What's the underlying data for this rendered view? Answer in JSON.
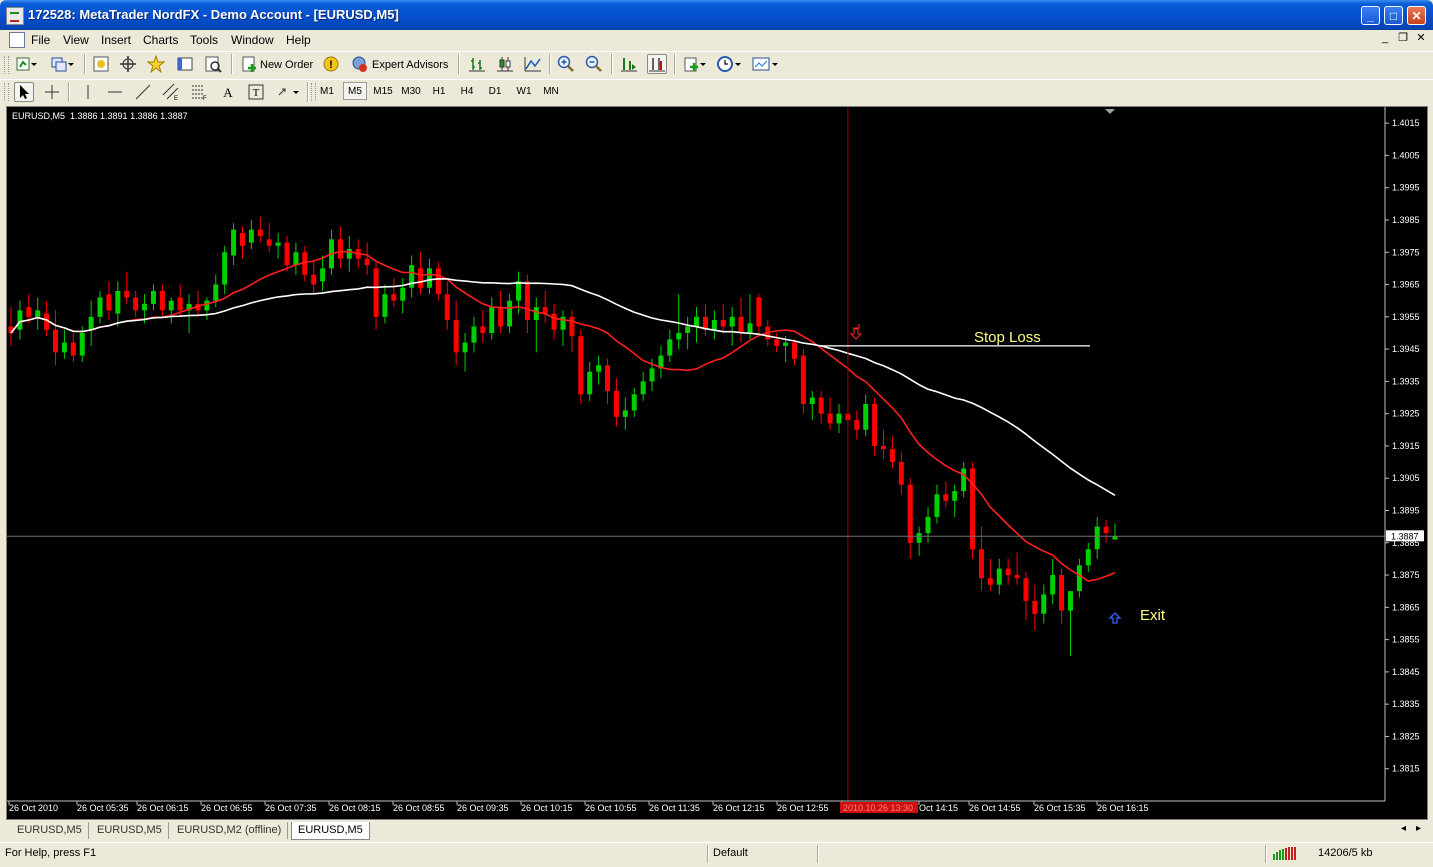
{
  "window": {
    "title": "172528: MetaTrader NordFX - Demo Account - [EURUSD,M5]",
    "minimize": "_",
    "maximize": "□",
    "close": "✕"
  },
  "menu": {
    "items": [
      "File",
      "View",
      "Insert",
      "Charts",
      "Tools",
      "Window",
      "Help"
    ]
  },
  "toolbar": {
    "new_order_label": "New Order",
    "expert_advisors_label": "Expert Advisors",
    "timeframes": [
      "M1",
      "M5",
      "M15",
      "M30",
      "H1",
      "H4",
      "D1",
      "W1",
      "MN"
    ],
    "active_timeframe": "M5"
  },
  "chart": {
    "info": "EURUSD,M5  1.3886 1.3891 1.3886 1.3887",
    "price_ticks": [
      "1.4015",
      "1.4005",
      "1.3995",
      "1.3985",
      "1.3975",
      "1.3965",
      "1.3955",
      "1.3945",
      "1.3935",
      "1.3925",
      "1.3915",
      "1.3905",
      "1.3895",
      "1.3885",
      "1.3875",
      "1.3865",
      "1.3855",
      "1.3845",
      "1.3835",
      "1.3825",
      "1.3815"
    ],
    "current_price": "1.3887",
    "time_labels": [
      "26 Oct 2010",
      "26 Oct 05:35",
      "26 Oct 06:15",
      "26 Oct 06:55",
      "26 Oct 07:35",
      "26 Oct 08:15",
      "26 Oct 08:55",
      "26 Oct 09:35",
      "26 Oct 10:15",
      "26 Oct 10:55",
      "26 Oct 11:35",
      "26 Oct 12:15",
      "26 Oct 12:55",
      "2010.10.26 13:30",
      "Oct 14:15",
      "26 Oct 14:55",
      "26 Oct 15:35",
      "26 Oct 16:15"
    ],
    "stop_loss_label": "Stop Loss",
    "exit_label": "Exit",
    "colors": {
      "background": "#000000",
      "bull": "#00d000",
      "bear": "#ff0000",
      "ma_fast": "#ff2020",
      "ma_slow": "#ffffff",
      "annotation_text": "#ffff80",
      "crosshair": "#a00000",
      "bid_line": "#707070"
    }
  },
  "chart_data": {
    "type": "candlestick",
    "symbol": "EURUSD",
    "timeframe": "M5",
    "ylim": [
      1.3805,
      1.402
    ],
    "candles": [
      {
        "o": 1.3952,
        "h": 1.3958,
        "l": 1.3946,
        "c": 1.395
      },
      {
        "o": 1.3951,
        "h": 1.396,
        "l": 1.3948,
        "c": 1.3957
      },
      {
        "o": 1.3958,
        "h": 1.3962,
        "l": 1.3953,
        "c": 1.3955
      },
      {
        "o": 1.3955,
        "h": 1.3961,
        "l": 1.3951,
        "c": 1.3957
      },
      {
        "o": 1.3956,
        "h": 1.396,
        "l": 1.3949,
        "c": 1.3951
      },
      {
        "o": 1.3951,
        "h": 1.3957,
        "l": 1.394,
        "c": 1.3944
      },
      {
        "o": 1.3944,
        "h": 1.3951,
        "l": 1.3942,
        "c": 1.3947
      },
      {
        "o": 1.3947,
        "h": 1.395,
        "l": 1.3941,
        "c": 1.3943
      },
      {
        "o": 1.3943,
        "h": 1.3952,
        "l": 1.3941,
        "c": 1.395
      },
      {
        "o": 1.3951,
        "h": 1.396,
        "l": 1.3946,
        "c": 1.3955
      },
      {
        "o": 1.3955,
        "h": 1.3963,
        "l": 1.3953,
        "c": 1.3961
      },
      {
        "o": 1.3962,
        "h": 1.3966,
        "l": 1.3954,
        "c": 1.3957
      },
      {
        "o": 1.3956,
        "h": 1.3966,
        "l": 1.3952,
        "c": 1.3963
      },
      {
        "o": 1.3963,
        "h": 1.3969,
        "l": 1.3959,
        "c": 1.3961
      },
      {
        "o": 1.3961,
        "h": 1.3963,
        "l": 1.3955,
        "c": 1.3957
      },
      {
        "o": 1.3957,
        "h": 1.3962,
        "l": 1.3953,
        "c": 1.3959
      },
      {
        "o": 1.3959,
        "h": 1.3965,
        "l": 1.3957,
        "c": 1.3963
      },
      {
        "o": 1.3963,
        "h": 1.3965,
        "l": 1.3955,
        "c": 1.3957
      },
      {
        "o": 1.3957,
        "h": 1.3961,
        "l": 1.3953,
        "c": 1.396
      },
      {
        "o": 1.3961,
        "h": 1.3965,
        "l": 1.3955,
        "c": 1.3957
      },
      {
        "o": 1.3957,
        "h": 1.3962,
        "l": 1.395,
        "c": 1.3959
      },
      {
        "o": 1.3959,
        "h": 1.3963,
        "l": 1.3955,
        "c": 1.3957
      },
      {
        "o": 1.3957,
        "h": 1.3961,
        "l": 1.3954,
        "c": 1.396
      },
      {
        "o": 1.396,
        "h": 1.3968,
        "l": 1.3958,
        "c": 1.3965
      },
      {
        "o": 1.3965,
        "h": 1.3977,
        "l": 1.3962,
        "c": 1.3975
      },
      {
        "o": 1.3974,
        "h": 1.3984,
        "l": 1.3971,
        "c": 1.3982
      },
      {
        "o": 1.3981,
        "h": 1.3983,
        "l": 1.3973,
        "c": 1.3977
      },
      {
        "o": 1.3978,
        "h": 1.3985,
        "l": 1.3976,
        "c": 1.3982
      },
      {
        "o": 1.3982,
        "h": 1.3986,
        "l": 1.3978,
        "c": 1.398
      },
      {
        "o": 1.3979,
        "h": 1.3984,
        "l": 1.3975,
        "c": 1.3977
      },
      {
        "o": 1.3977,
        "h": 1.3981,
        "l": 1.3973,
        "c": 1.3978
      },
      {
        "o": 1.3978,
        "h": 1.398,
        "l": 1.3969,
        "c": 1.3971
      },
      {
        "o": 1.3971,
        "h": 1.3978,
        "l": 1.3968,
        "c": 1.3975
      },
      {
        "o": 1.3975,
        "h": 1.3977,
        "l": 1.3966,
        "c": 1.3968
      },
      {
        "o": 1.3968,
        "h": 1.3972,
        "l": 1.3962,
        "c": 1.3965
      },
      {
        "o": 1.3966,
        "h": 1.3974,
        "l": 1.3963,
        "c": 1.397
      },
      {
        "o": 1.397,
        "h": 1.3982,
        "l": 1.3968,
        "c": 1.3979
      },
      {
        "o": 1.3979,
        "h": 1.3983,
        "l": 1.397,
        "c": 1.3973
      },
      {
        "o": 1.3973,
        "h": 1.398,
        "l": 1.3969,
        "c": 1.3976
      },
      {
        "o": 1.3976,
        "h": 1.3979,
        "l": 1.397,
        "c": 1.3973
      },
      {
        "o": 1.3973,
        "h": 1.3978,
        "l": 1.3968,
        "c": 1.3971
      },
      {
        "o": 1.397,
        "h": 1.3972,
        "l": 1.3951,
        "c": 1.3955
      },
      {
        "o": 1.3955,
        "h": 1.3965,
        "l": 1.3953,
        "c": 1.3962
      },
      {
        "o": 1.3962,
        "h": 1.3967,
        "l": 1.3958,
        "c": 1.396
      },
      {
        "o": 1.396,
        "h": 1.3967,
        "l": 1.3956,
        "c": 1.3964
      },
      {
        "o": 1.3964,
        "h": 1.3974,
        "l": 1.3961,
        "c": 1.3971
      },
      {
        "o": 1.397,
        "h": 1.3975,
        "l": 1.3962,
        "c": 1.3964
      },
      {
        "o": 1.3964,
        "h": 1.3973,
        "l": 1.3962,
        "c": 1.397
      },
      {
        "o": 1.397,
        "h": 1.3972,
        "l": 1.396,
        "c": 1.3962
      },
      {
        "o": 1.3962,
        "h": 1.3966,
        "l": 1.3951,
        "c": 1.3954
      },
      {
        "o": 1.3954,
        "h": 1.396,
        "l": 1.394,
        "c": 1.3944
      },
      {
        "o": 1.3944,
        "h": 1.395,
        "l": 1.3938,
        "c": 1.3947
      },
      {
        "o": 1.3947,
        "h": 1.3955,
        "l": 1.3944,
        "c": 1.3952
      },
      {
        "o": 1.3952,
        "h": 1.3957,
        "l": 1.3947,
        "c": 1.395
      },
      {
        "o": 1.395,
        "h": 1.3961,
        "l": 1.3948,
        "c": 1.3958
      },
      {
        "o": 1.3958,
        "h": 1.3963,
        "l": 1.395,
        "c": 1.3952
      },
      {
        "o": 1.3952,
        "h": 1.3962,
        "l": 1.395,
        "c": 1.396
      },
      {
        "o": 1.396,
        "h": 1.3969,
        "l": 1.3956,
        "c": 1.3966
      },
      {
        "o": 1.3966,
        "h": 1.3968,
        "l": 1.395,
        "c": 1.3954
      },
      {
        "o": 1.3954,
        "h": 1.3961,
        "l": 1.3944,
        "c": 1.3958
      },
      {
        "o": 1.3958,
        "h": 1.3963,
        "l": 1.3953,
        "c": 1.3956
      },
      {
        "o": 1.3956,
        "h": 1.3959,
        "l": 1.3948,
        "c": 1.3951
      },
      {
        "o": 1.3951,
        "h": 1.3957,
        "l": 1.3946,
        "c": 1.3955
      },
      {
        "o": 1.3955,
        "h": 1.3957,
        "l": 1.3944,
        "c": 1.3949
      },
      {
        "o": 1.3949,
        "h": 1.3951,
        "l": 1.3928,
        "c": 1.3931
      },
      {
        "o": 1.3931,
        "h": 1.3941,
        "l": 1.3929,
        "c": 1.3938
      },
      {
        "o": 1.3938,
        "h": 1.3943,
        "l": 1.3934,
        "c": 1.394
      },
      {
        "o": 1.394,
        "h": 1.3942,
        "l": 1.3928,
        "c": 1.3932
      },
      {
        "o": 1.3932,
        "h": 1.3936,
        "l": 1.3921,
        "c": 1.3924
      },
      {
        "o": 1.3924,
        "h": 1.393,
        "l": 1.392,
        "c": 1.3926
      },
      {
        "o": 1.3926,
        "h": 1.3933,
        "l": 1.3924,
        "c": 1.3931
      },
      {
        "o": 1.3931,
        "h": 1.3938,
        "l": 1.3929,
        "c": 1.3935
      },
      {
        "o": 1.3935,
        "h": 1.3942,
        "l": 1.3932,
        "c": 1.3939
      },
      {
        "o": 1.3939,
        "h": 1.3946,
        "l": 1.3936,
        "c": 1.3943
      },
      {
        "o": 1.3943,
        "h": 1.3951,
        "l": 1.3941,
        "c": 1.3948
      },
      {
        "o": 1.3948,
        "h": 1.3962,
        "l": 1.3945,
        "c": 1.395
      },
      {
        "o": 1.395,
        "h": 1.3955,
        "l": 1.3945,
        "c": 1.3952
      },
      {
        "o": 1.3952,
        "h": 1.3958,
        "l": 1.3947,
        "c": 1.3955
      },
      {
        "o": 1.3955,
        "h": 1.3959,
        "l": 1.3949,
        "c": 1.3951
      },
      {
        "o": 1.3951,
        "h": 1.3957,
        "l": 1.3948,
        "c": 1.3954
      },
      {
        "o": 1.3954,
        "h": 1.3959,
        "l": 1.395,
        "c": 1.3952
      },
      {
        "o": 1.3952,
        "h": 1.3958,
        "l": 1.3946,
        "c": 1.3955
      },
      {
        "o": 1.3955,
        "h": 1.3961,
        "l": 1.3947,
        "c": 1.395
      },
      {
        "o": 1.395,
        "h": 1.3962,
        "l": 1.3948,
        "c": 1.3953
      },
      {
        "o": 1.3961,
        "h": 1.3962,
        "l": 1.395,
        "c": 1.3952
      },
      {
        "o": 1.3952,
        "h": 1.3954,
        "l": 1.3946,
        "c": 1.3948
      },
      {
        "o": 1.3948,
        "h": 1.395,
        "l": 1.3944,
        "c": 1.3946
      },
      {
        "o": 1.3946,
        "h": 1.3949,
        "l": 1.3941,
        "c": 1.3947
      },
      {
        "o": 1.3947,
        "h": 1.3948,
        "l": 1.394,
        "c": 1.3942
      },
      {
        "o": 1.3943,
        "h": 1.3945,
        "l": 1.3925,
        "c": 1.3928
      },
      {
        "o": 1.3928,
        "h": 1.3932,
        "l": 1.3923,
        "c": 1.393
      },
      {
        "o": 1.393,
        "h": 1.3932,
        "l": 1.3922,
        "c": 1.3925
      },
      {
        "o": 1.3925,
        "h": 1.393,
        "l": 1.392,
        "c": 1.3922
      },
      {
        "o": 1.3922,
        "h": 1.3928,
        "l": 1.3919,
        "c": 1.3925
      },
      {
        "o": 1.3925,
        "h": 1.3929,
        "l": 1.3921,
        "c": 1.3923
      },
      {
        "o": 1.3923,
        "h": 1.3926,
        "l": 1.3917,
        "c": 1.392
      },
      {
        "o": 1.392,
        "h": 1.3931,
        "l": 1.3918,
        "c": 1.3928
      },
      {
        "o": 1.3928,
        "h": 1.393,
        "l": 1.3912,
        "c": 1.3915
      },
      {
        "o": 1.3915,
        "h": 1.392,
        "l": 1.3911,
        "c": 1.3914
      },
      {
        "o": 1.3914,
        "h": 1.3918,
        "l": 1.3908,
        "c": 1.391
      },
      {
        "o": 1.391,
        "h": 1.3913,
        "l": 1.39,
        "c": 1.3903
      },
      {
        "o": 1.3903,
        "h": 1.3905,
        "l": 1.388,
        "c": 1.3885
      },
      {
        "o": 1.3885,
        "h": 1.389,
        "l": 1.3881,
        "c": 1.3888
      },
      {
        "o": 1.3888,
        "h": 1.3896,
        "l": 1.3885,
        "c": 1.3893
      },
      {
        "o": 1.3893,
        "h": 1.3903,
        "l": 1.3891,
        "c": 1.39
      },
      {
        "o": 1.39,
        "h": 1.3904,
        "l": 1.3896,
        "c": 1.3898
      },
      {
        "o": 1.3898,
        "h": 1.3903,
        "l": 1.3893,
        "c": 1.3901
      },
      {
        "o": 1.3901,
        "h": 1.391,
        "l": 1.3899,
        "c": 1.3908
      },
      {
        "o": 1.3908,
        "h": 1.391,
        "l": 1.388,
        "c": 1.3883
      },
      {
        "o": 1.3883,
        "h": 1.389,
        "l": 1.387,
        "c": 1.3874
      },
      {
        "o": 1.3874,
        "h": 1.388,
        "l": 1.387,
        "c": 1.3872
      },
      {
        "o": 1.3872,
        "h": 1.388,
        "l": 1.3869,
        "c": 1.3877
      },
      {
        "o": 1.3877,
        "h": 1.388,
        "l": 1.3872,
        "c": 1.3875
      },
      {
        "o": 1.3875,
        "h": 1.3882,
        "l": 1.3872,
        "c": 1.3874
      },
      {
        "o": 1.3874,
        "h": 1.3876,
        "l": 1.3861,
        "c": 1.3867
      },
      {
        "o": 1.3867,
        "h": 1.3872,
        "l": 1.3858,
        "c": 1.3863
      },
      {
        "o": 1.3863,
        "h": 1.3872,
        "l": 1.386,
        "c": 1.3869
      },
      {
        "o": 1.3869,
        "h": 1.388,
        "l": 1.3866,
        "c": 1.3875
      },
      {
        "o": 1.3875,
        "h": 1.3877,
        "l": 1.386,
        "c": 1.3864
      },
      {
        "o": 1.3864,
        "h": 1.387,
        "l": 1.385,
        "c": 1.387
      },
      {
        "o": 1.387,
        "h": 1.388,
        "l": 1.3868,
        "c": 1.3878
      },
      {
        "o": 1.3878,
        "h": 1.3885,
        "l": 1.3876,
        "c": 1.3883
      },
      {
        "o": 1.3883,
        "h": 1.3893,
        "l": 1.388,
        "c": 1.389
      },
      {
        "o": 1.389,
        "h": 1.3892,
        "l": 1.3885,
        "c": 1.3888
      },
      {
        "o": 1.3886,
        "h": 1.3891,
        "l": 1.3886,
        "c": 1.3887
      }
    ]
  }
}
